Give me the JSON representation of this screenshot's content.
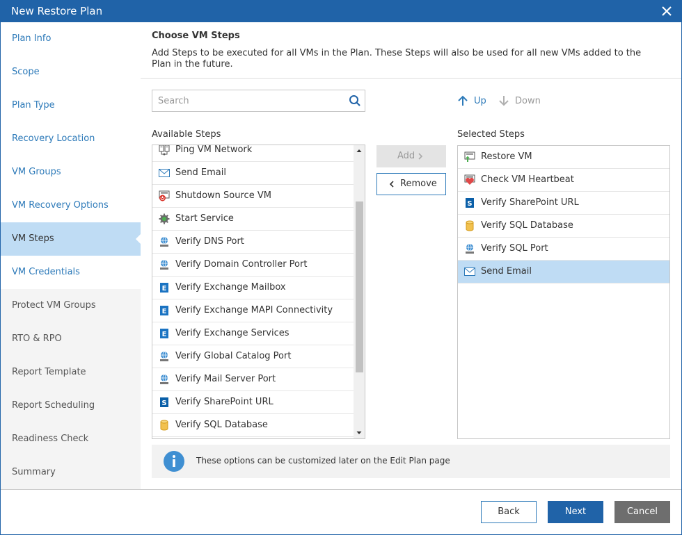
{
  "window": {
    "title": "New Restore Plan"
  },
  "sidebar": {
    "items": [
      {
        "label": "Plan Info",
        "state": "done"
      },
      {
        "label": "Scope",
        "state": "done"
      },
      {
        "label": "Plan Type",
        "state": "done"
      },
      {
        "label": "Recovery Location",
        "state": "done"
      },
      {
        "label": "VM Groups",
        "state": "done"
      },
      {
        "label": "VM Recovery Options",
        "state": "done"
      },
      {
        "label": "VM Steps",
        "state": "active"
      },
      {
        "label": "VM Credentials",
        "state": "done"
      },
      {
        "label": "Protect VM Groups",
        "state": "pending"
      },
      {
        "label": "RTO & RPO",
        "state": "pending"
      },
      {
        "label": "Report Template",
        "state": "pending"
      },
      {
        "label": "Report Scheduling",
        "state": "pending"
      },
      {
        "label": "Readiness Check",
        "state": "pending"
      },
      {
        "label": "Summary",
        "state": "pending"
      }
    ]
  },
  "main": {
    "title": "Choose VM Steps",
    "description": "Add Steps to be executed for all VMs in the Plan. These Steps will also be used for all new VMs added to the Plan in the future.",
    "search": {
      "placeholder": "Search",
      "value": ""
    },
    "order": {
      "up_label": "Up",
      "down_label": "Down"
    },
    "available_label": "Available Steps",
    "selected_label": "Selected Steps",
    "available_steps": [
      {
        "label": "Ping VM Network",
        "icon": "network-icon"
      },
      {
        "label": "Send Email",
        "icon": "email-icon"
      },
      {
        "label": "Shutdown Source VM",
        "icon": "shutdown-icon"
      },
      {
        "label": "Start Service",
        "icon": "service-gear-icon"
      },
      {
        "label": "Verify DNS Port",
        "icon": "port-globe-icon"
      },
      {
        "label": "Verify Domain Controller Port",
        "icon": "port-globe-icon"
      },
      {
        "label": "Verify Exchange Mailbox",
        "icon": "exchange-icon"
      },
      {
        "label": "Verify Exchange MAPI Connectivity",
        "icon": "exchange-icon"
      },
      {
        "label": "Verify Exchange Services",
        "icon": "exchange-icon"
      },
      {
        "label": "Verify Global Catalog Port",
        "icon": "port-globe-icon"
      },
      {
        "label": "Verify Mail Server Port",
        "icon": "port-globe-icon"
      },
      {
        "label": "Verify SharePoint URL",
        "icon": "sharepoint-icon"
      },
      {
        "label": "Verify SQL Database",
        "icon": "database-icon"
      }
    ],
    "selected_steps": [
      {
        "label": "Restore VM",
        "icon": "restore-vm-icon"
      },
      {
        "label": "Check VM Heartbeat",
        "icon": "heartbeat-icon"
      },
      {
        "label": "Verify SharePoint URL",
        "icon": "sharepoint-icon"
      },
      {
        "label": "Verify SQL Database",
        "icon": "database-icon"
      },
      {
        "label": "Verify SQL Port",
        "icon": "port-globe-icon"
      },
      {
        "label": "Send Email",
        "icon": "email-icon",
        "selected": true
      }
    ],
    "add_label": "Add",
    "remove_label": "Remove",
    "info_text": "These options can be customized later on the Edit Plan page"
  },
  "footer": {
    "back_label": "Back",
    "next_label": "Next",
    "cancel_label": "Cancel"
  },
  "colors": {
    "accent": "#2063a8",
    "link": "#2d7ab9",
    "active_nav": "#bfdcf4",
    "selected_row": "#bfdcf4"
  }
}
